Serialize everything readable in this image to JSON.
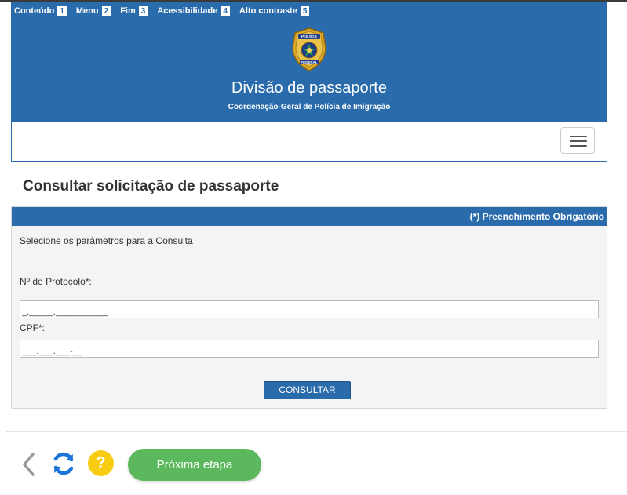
{
  "skip_links": [
    {
      "label": "Conteúdo",
      "key": "1"
    },
    {
      "label": "Menu",
      "key": "2"
    },
    {
      "label": "Fim",
      "key": "3"
    },
    {
      "label": "Acessibilidade",
      "key": "4"
    },
    {
      "label": "Alto contraste",
      "key": "5"
    }
  ],
  "header": {
    "logo_text_top": "POLÍCIA",
    "logo_text_bottom": "FEDERAL",
    "title": "Divisão de passaporte",
    "subtitle": "Coordenação-Geral de Polícia de Imigração"
  },
  "page": {
    "title": "Consultar solicitação de passaporte"
  },
  "panel": {
    "required_note": "(*) Preenchimento Obrigatório",
    "intro": "Selecione os parâmetros para a Consulta",
    "protocol_label": "Nº de Protocolo*:",
    "protocol_value": "_._____.___________",
    "cpf_label": "CPF*:",
    "cpf_value": "___.___.___-__",
    "submit_label": "CONSULTAR"
  },
  "footer": {
    "help_glyph": "?",
    "next_label": "Próxima etapa"
  },
  "colors": {
    "header_blue": "#2a6bab",
    "help_yellow": "#f7cc12",
    "next_green": "#5cb85c",
    "refresh_blue": "#1a73d9"
  }
}
